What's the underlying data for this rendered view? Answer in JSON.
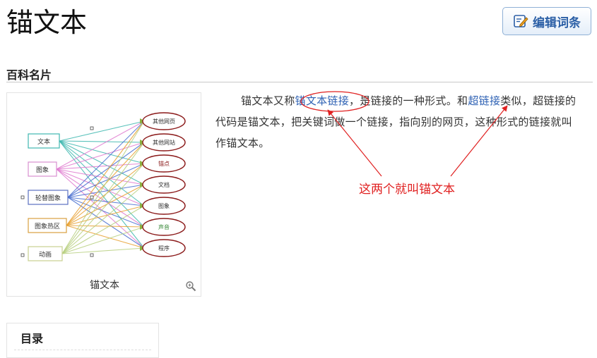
{
  "entry": {
    "title": "锚文本",
    "edit_button_label": "编辑词条"
  },
  "section": {
    "card_heading": "百科名片"
  },
  "image": {
    "caption": "锚文本",
    "diagram": {
      "sources": [
        "文本",
        "图象",
        "轮替图象",
        "图象热区",
        "动画"
      ],
      "targets": [
        "其他网页",
        "其他网站",
        "锚点",
        "文档",
        "图象",
        "声音",
        "程序"
      ]
    }
  },
  "intro": {
    "part1": "锚文本又称",
    "link1": "锚文本链接",
    "part2": "，是链接的一种形式。和",
    "link2": "超链接",
    "part3": "类似，超链接的代码是锚文本，把关键词做一个链接，指向别的网页，这种形式的链接就叫作锚文本。"
  },
  "annotation": {
    "text": "这两个就叫锚文本",
    "color": "#e02020"
  },
  "toc": {
    "title": "目录"
  },
  "colors": {
    "link": "#2f62b4",
    "edit_button_text": "#2b5fa6"
  }
}
